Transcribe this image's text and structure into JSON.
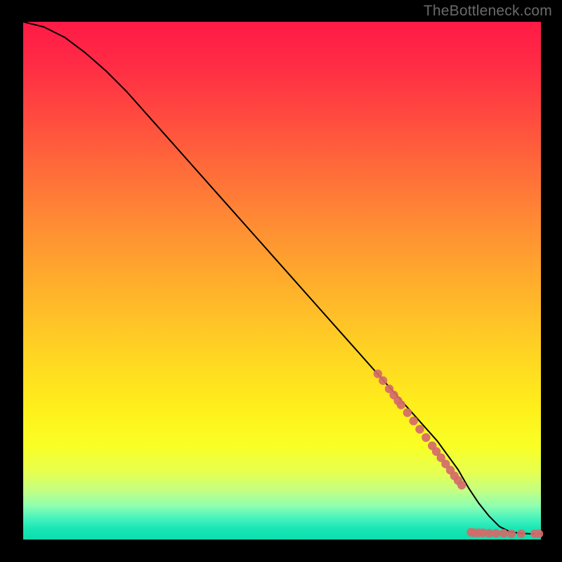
{
  "watermark": "TheBottleneck.com",
  "colors": {
    "curve_stroke": "#000000",
    "marker_fill": "#d46a6a",
    "marker_stroke": "#d46a6a"
  },
  "chart_data": {
    "type": "line",
    "title": "",
    "xlabel": "",
    "ylabel": "",
    "xlim": [
      0,
      100
    ],
    "ylim": [
      0,
      100
    ],
    "grid": false,
    "series": [
      {
        "name": "bottleneck-curve",
        "x": [
          0,
          4,
          8,
          12,
          16,
          20,
          24,
          28,
          32,
          36,
          40,
          44,
          48,
          52,
          56,
          60,
          64,
          68,
          72,
          76,
          80,
          84,
          86,
          88,
          90,
          92,
          94,
          96,
          98,
          100
        ],
        "y": [
          100,
          99,
          97,
          94,
          90.5,
          86.5,
          82,
          77.5,
          73,
          68.5,
          64,
          59.5,
          55,
          50.5,
          46,
          41.5,
          37,
          32.5,
          28,
          23.5,
          19,
          13.5,
          10,
          7,
          4.5,
          2.5,
          1.5,
          1.2,
          1.1,
          1.1
        ]
      }
    ],
    "markers": [
      {
        "name": "segment-cluster-upper",
        "points": [
          {
            "x": 68.5,
            "y": 32.0
          },
          {
            "x": 69.5,
            "y": 30.7
          },
          {
            "x": 70.7,
            "y": 29.1
          },
          {
            "x": 71.6,
            "y": 27.9
          },
          {
            "x": 72.4,
            "y": 26.8
          },
          {
            "x": 73.0,
            "y": 26.0
          },
          {
            "x": 74.2,
            "y": 24.5
          },
          {
            "x": 75.4,
            "y": 22.9
          },
          {
            "x": 76.6,
            "y": 21.3
          },
          {
            "x": 77.8,
            "y": 19.7
          },
          {
            "x": 79.0,
            "y": 18.1
          },
          {
            "x": 79.8,
            "y": 17.0
          },
          {
            "x": 80.7,
            "y": 15.8
          },
          {
            "x": 81.6,
            "y": 14.6
          },
          {
            "x": 82.5,
            "y": 13.4
          },
          {
            "x": 83.3,
            "y": 12.3
          },
          {
            "x": 84.0,
            "y": 11.4
          },
          {
            "x": 84.7,
            "y": 10.5
          }
        ]
      },
      {
        "name": "segment-cluster-lower",
        "points": [
          {
            "x": 86.5,
            "y": 1.4
          },
          {
            "x": 87.2,
            "y": 1.3
          },
          {
            "x": 88.0,
            "y": 1.3
          },
          {
            "x": 88.8,
            "y": 1.3
          },
          {
            "x": 90.0,
            "y": 1.2
          },
          {
            "x": 91.3,
            "y": 1.2
          },
          {
            "x": 92.8,
            "y": 1.2
          },
          {
            "x": 94.3,
            "y": 1.1
          },
          {
            "x": 96.2,
            "y": 1.1
          },
          {
            "x": 98.8,
            "y": 1.1
          },
          {
            "x": 99.6,
            "y": 1.1
          }
        ]
      }
    ]
  }
}
